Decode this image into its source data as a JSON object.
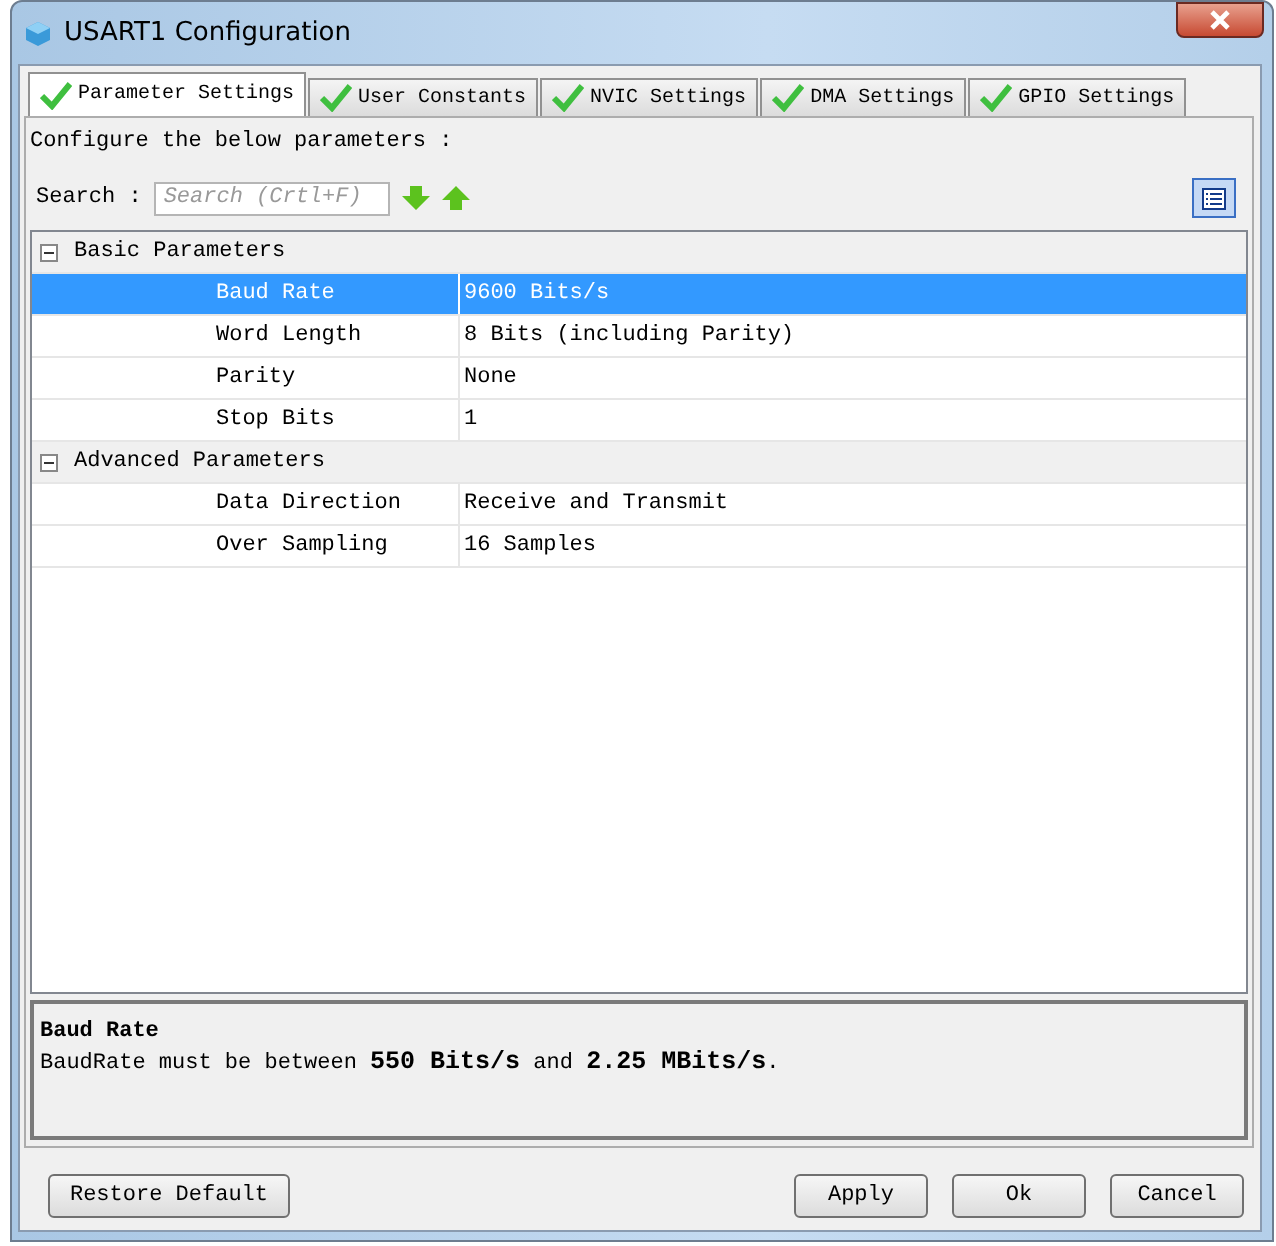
{
  "window": {
    "title": "USART1 Configuration"
  },
  "tabs": [
    {
      "label": "Parameter Settings",
      "selected": true
    },
    {
      "label": "User Constants",
      "selected": false
    },
    {
      "label": "NVIC Settings",
      "selected": false
    },
    {
      "label": "DMA Settings",
      "selected": false
    },
    {
      "label": "GPIO Settings",
      "selected": false
    }
  ],
  "intro": "Configure the below parameters :",
  "search": {
    "label": "Search :",
    "placeholder": "Search (Crtl+F)"
  },
  "groups": [
    {
      "label": "Basic Parameters",
      "expanded": true,
      "children": [
        {
          "name": "Baud Rate",
          "value": "9600 Bits/s",
          "selected": true
        },
        {
          "name": "Word Length",
          "value": "8 Bits (including Parity)",
          "selected": false
        },
        {
          "name": "Parity",
          "value": "None",
          "selected": false
        },
        {
          "name": "Stop Bits",
          "value": "1",
          "selected": false
        }
      ]
    },
    {
      "label": "Advanced Parameters",
      "expanded": true,
      "children": [
        {
          "name": "Data Direction",
          "value": "Receive and Transmit",
          "selected": false
        },
        {
          "name": "Over Sampling",
          "value": "16 Samples",
          "selected": false
        }
      ]
    }
  ],
  "description": {
    "title": "Baud Rate",
    "text": "BaudRate must be between **550 Bits/s** and **2.25 MBits/s**."
  },
  "buttons": {
    "left": "Restore Default",
    "right": [
      "Apply",
      "Ok",
      "Cancel"
    ]
  }
}
